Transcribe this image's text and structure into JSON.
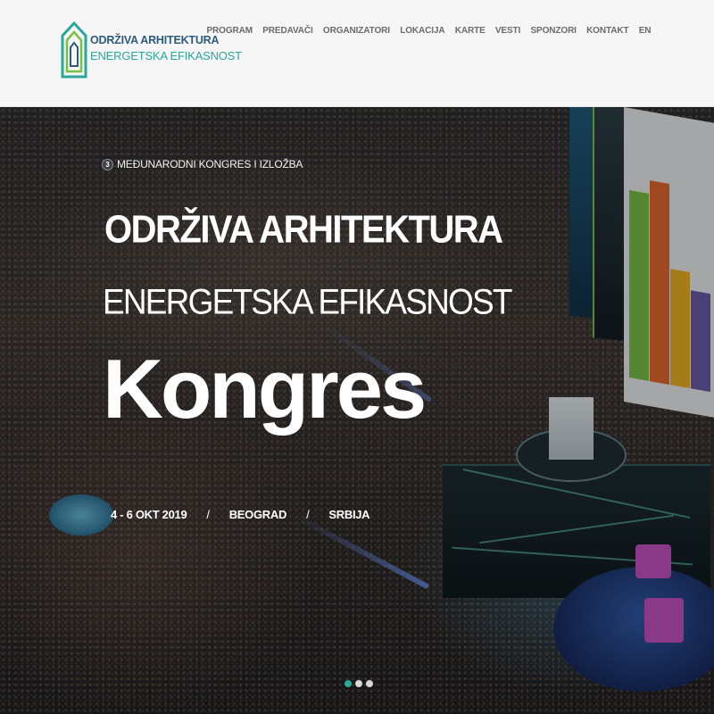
{
  "header": {
    "logo": {
      "line1": "ODRŽIVA ARHITEKTURA",
      "line2": "ENERGETSKA EFIKASNOST",
      "icon": "house-logo-icon",
      "colors": {
        "primary": "#2d5c7a",
        "accent": "#2aa898"
      }
    },
    "nav": [
      {
        "label": "PROGRAM"
      },
      {
        "label": "PREDAVAČI"
      },
      {
        "label": "ORGANIZATORI"
      },
      {
        "label": "LOKACIJA"
      },
      {
        "label": "KARTE"
      },
      {
        "label": "VESTI"
      },
      {
        "label": "SPONZORI"
      },
      {
        "label": "KONTAKT"
      },
      {
        "label": "EN"
      }
    ]
  },
  "hero": {
    "kicker_number": "3",
    "kicker_text": "MEĐUNARODNI KONGRES I IZLOŽBA",
    "title_line1": "ODRŽIVA ARHITEKTURA",
    "title_line2": "ENERGETSKA EFIKASNOST",
    "title_line3": "Kongres",
    "date": "4 - 6 OKT 2019",
    "separator": "/",
    "city": "BEOGRAD",
    "country": "SRBIJA",
    "background": "conference-hall-photo"
  },
  "carousel": {
    "slide_count": 3,
    "active_index": 0
  }
}
